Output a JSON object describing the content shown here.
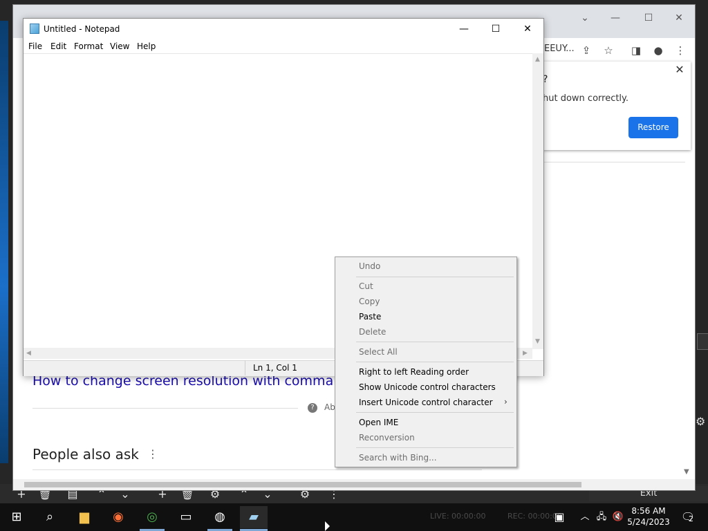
{
  "notepad": {
    "title": "Untitled - Notepad",
    "menus": [
      "File",
      "Edit",
      "Format",
      "View",
      "Help"
    ],
    "status": "Ln 1, Col 1"
  },
  "context_menu": {
    "items": [
      {
        "label": "Undo",
        "enabled": false
      },
      {
        "label": "Cut",
        "enabled": false
      },
      {
        "label": "Copy",
        "enabled": false
      },
      {
        "label": "Paste",
        "enabled": true
      },
      {
        "label": "Delete",
        "enabled": false
      },
      {
        "label": "Select All",
        "enabled": false
      },
      {
        "label": "Right to left Reading order",
        "enabled": true
      },
      {
        "label": "Show Unicode control characters",
        "enabled": true
      },
      {
        "label": "Insert Unicode control character",
        "enabled": true
      },
      {
        "label": "Open IME",
        "enabled": true
      },
      {
        "label": "Reconversion",
        "enabled": false
      },
      {
        "label": "Search with Bing...",
        "enabled": false
      }
    ]
  },
  "chrome": {
    "omnibox_tail": "EEUY...",
    "popup_question": "?",
    "popup_message": "hut down correctly.",
    "restore_label": "Restore",
    "result_link": "How to change screen resolution with command c",
    "about_text": "Ab",
    "people_also_ask": "People also ask"
  },
  "obs": {
    "exit_label": "Exit",
    "live": "LIVE: 00:00:00",
    "rec": "REC: 00:00:00"
  },
  "taskbar": {
    "time": "8:56 AM",
    "date": "5/24/2023",
    "notification_count": "2"
  },
  "colors": {
    "restore_button": "#1a73e8",
    "link": "#1a0dab",
    "taskbar": "#101010"
  }
}
